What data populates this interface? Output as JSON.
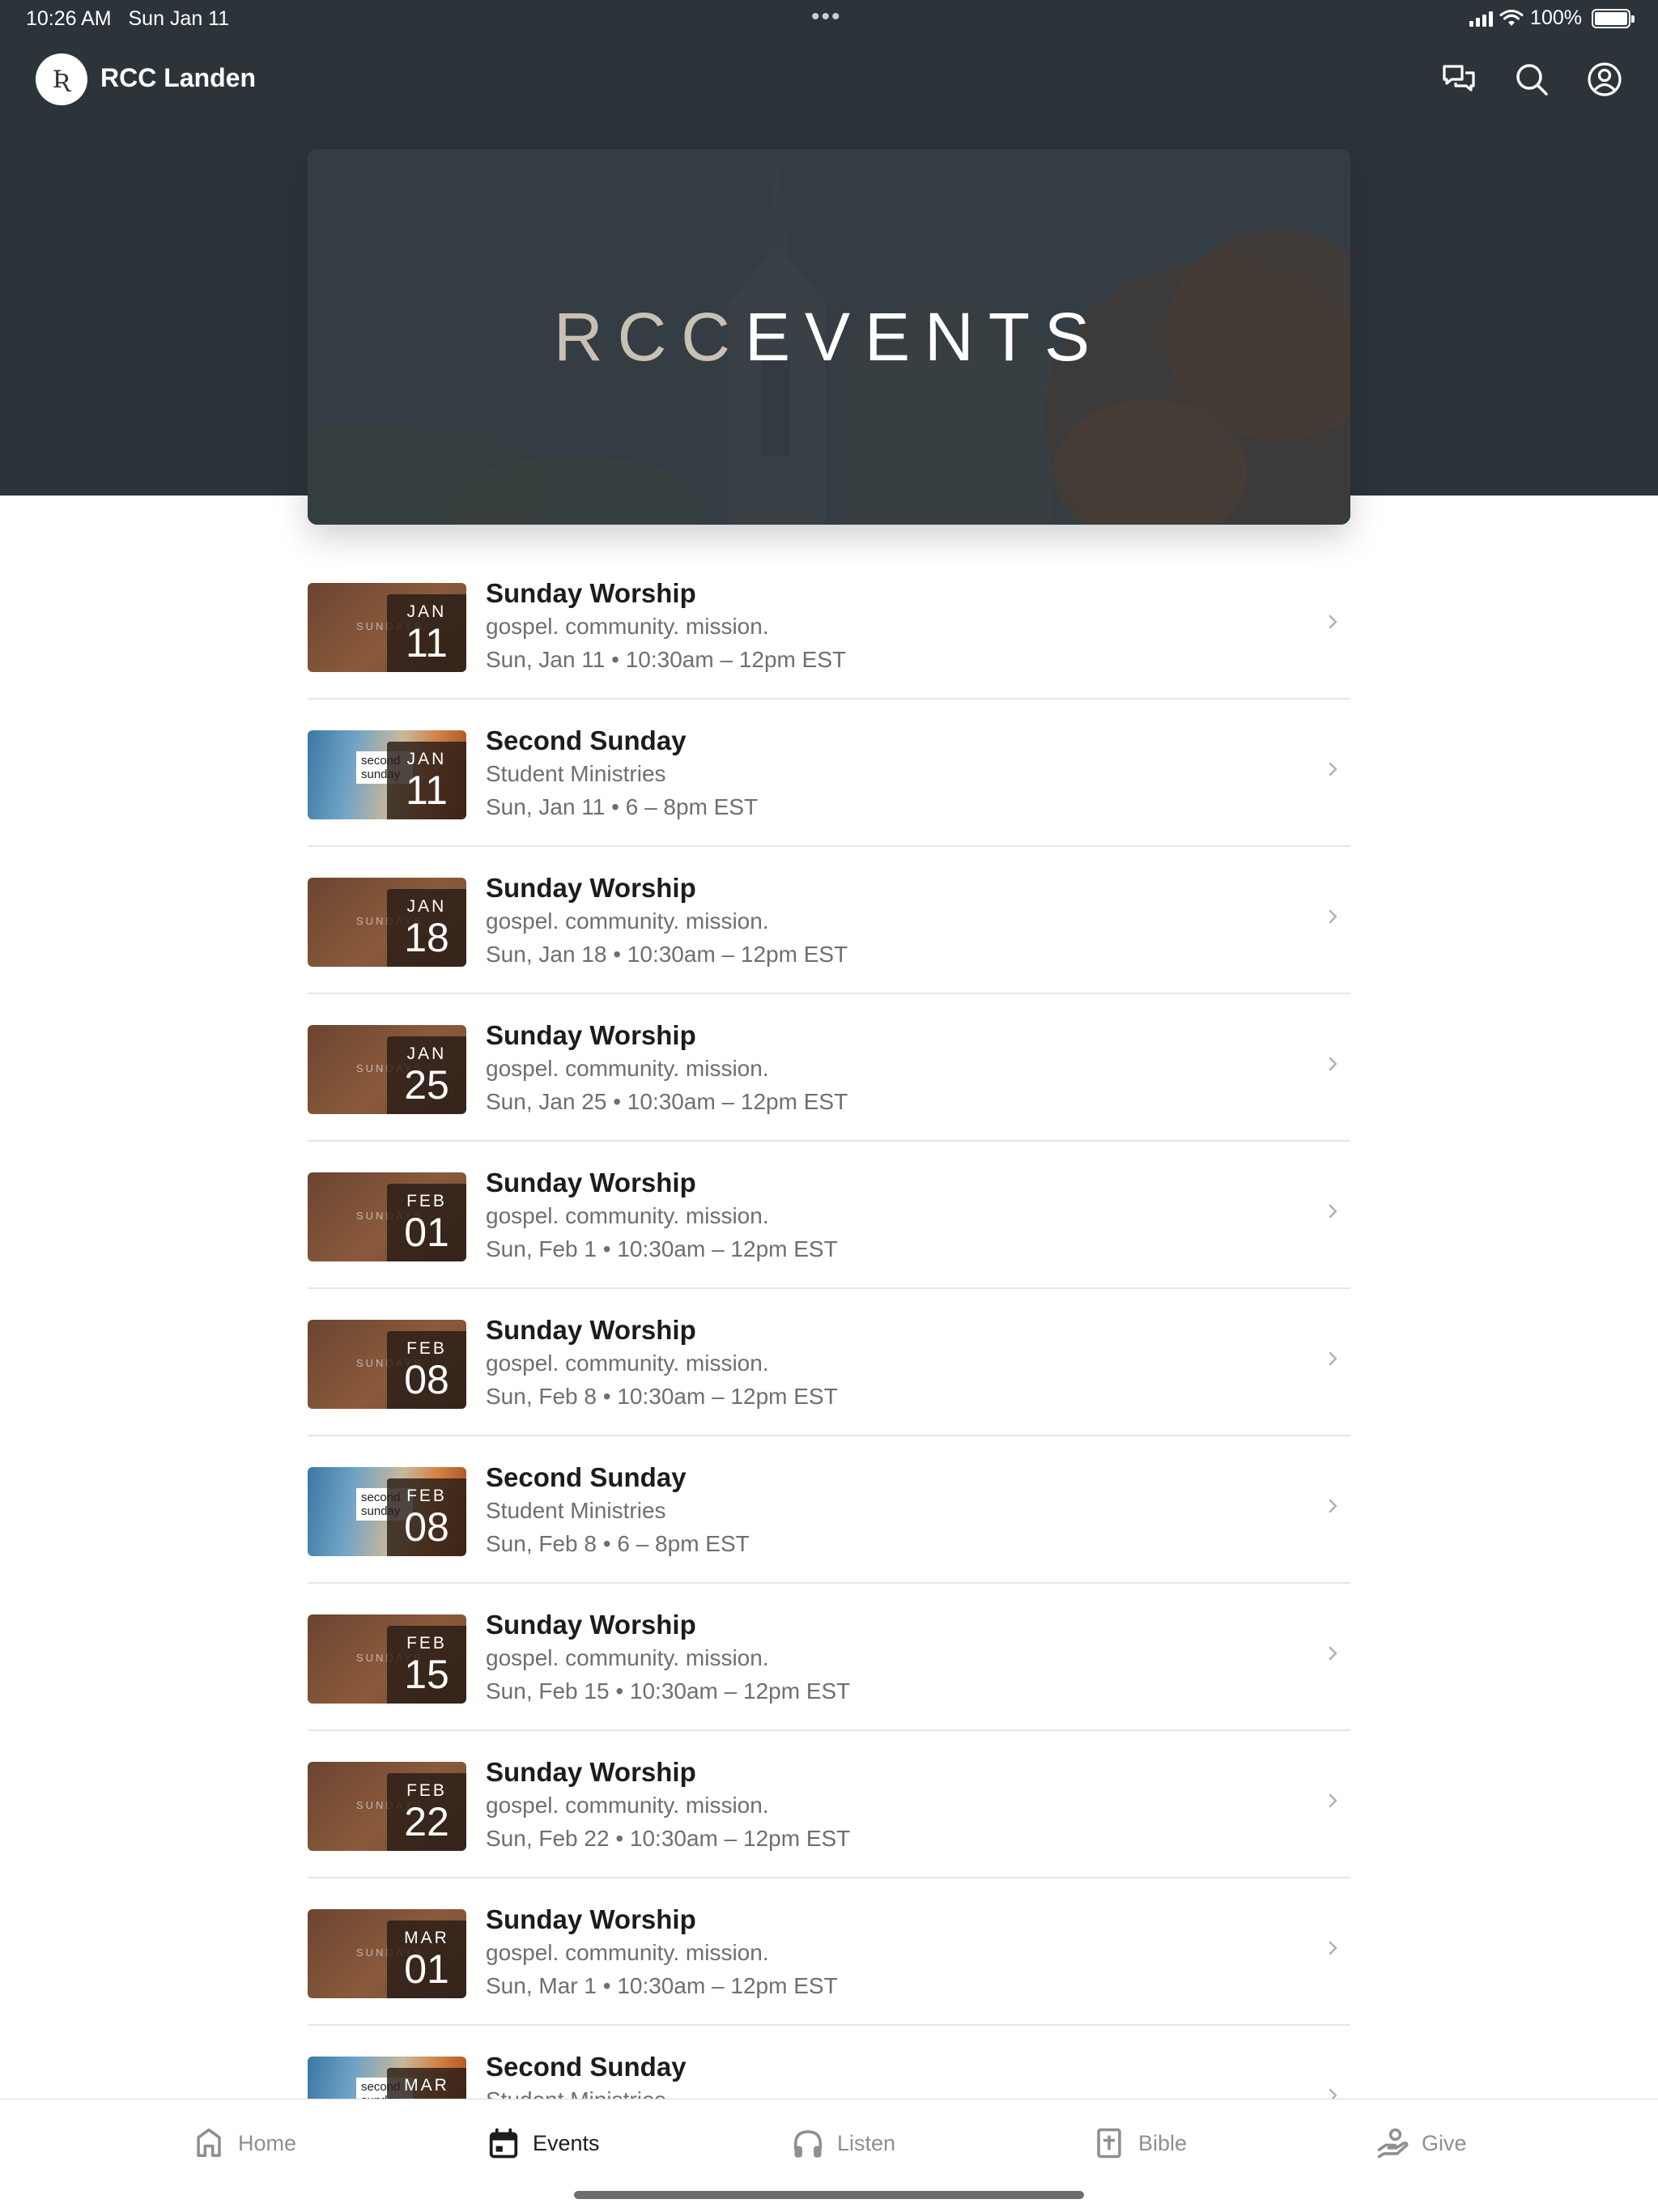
{
  "status_bar": {
    "time": "10:26 AM",
    "date": "Sun Jan 11",
    "dots": "•••",
    "battery": "100%"
  },
  "app_bar": {
    "logo_glyph": "Ʀ",
    "title": "RCC Landen",
    "icons": [
      "chat-icon",
      "search-icon",
      "profile-icon"
    ]
  },
  "hero": {
    "title_left": "RCC",
    "title_right": "EVENTS"
  },
  "events": [
    {
      "style": "sunday",
      "thumb_word": "SUNDAYS",
      "month": "JAN",
      "day": "11",
      "title": "Sunday Worship",
      "subtitle": "gospel. community. mission.",
      "time": "Sun, Jan 11 • 10:30am – 12pm EST"
    },
    {
      "style": "second",
      "thumb_word": "second sunday",
      "month": "JAN",
      "day": "11",
      "title": "Second Sunday",
      "subtitle": "Student Ministries",
      "time": "Sun, Jan 11 • 6 – 8pm EST"
    },
    {
      "style": "sunday",
      "thumb_word": "SUNDAYS",
      "month": "JAN",
      "day": "18",
      "title": "Sunday Worship",
      "subtitle": "gospel. community. mission.",
      "time": "Sun, Jan 18 • 10:30am – 12pm EST"
    },
    {
      "style": "sunday",
      "thumb_word": "SUNDAYS",
      "month": "JAN",
      "day": "25",
      "title": "Sunday Worship",
      "subtitle": "gospel. community. mission.",
      "time": "Sun, Jan 25 • 10:30am – 12pm EST"
    },
    {
      "style": "sunday",
      "thumb_word": "SUNDAYS",
      "month": "FEB",
      "day": "01",
      "title": "Sunday Worship",
      "subtitle": "gospel. community. mission.",
      "time": "Sun, Feb 1 • 10:30am – 12pm EST"
    },
    {
      "style": "sunday",
      "thumb_word": "SUNDAYS",
      "month": "FEB",
      "day": "08",
      "title": "Sunday Worship",
      "subtitle": "gospel. community. mission.",
      "time": "Sun, Feb 8 • 10:30am – 12pm EST"
    },
    {
      "style": "second",
      "thumb_word": "second sunday",
      "month": "FEB",
      "day": "08",
      "title": "Second Sunday",
      "subtitle": "Student Ministries",
      "time": "Sun, Feb 8 • 6 – 8pm EST"
    },
    {
      "style": "sunday",
      "thumb_word": "SUNDAYS",
      "month": "FEB",
      "day": "15",
      "title": "Sunday Worship",
      "subtitle": "gospel. community. mission.",
      "time": "Sun, Feb 15 • 10:30am – 12pm EST"
    },
    {
      "style": "sunday",
      "thumb_word": "SUNDAYS",
      "month": "FEB",
      "day": "22",
      "title": "Sunday Worship",
      "subtitle": "gospel. community. mission.",
      "time": "Sun, Feb 22 • 10:30am – 12pm EST"
    },
    {
      "style": "sunday",
      "thumb_word": "SUNDAYS",
      "month": "MAR",
      "day": "01",
      "title": "Sunday Worship",
      "subtitle": "gospel. community. mission.",
      "time": "Sun, Mar 1 • 10:30am – 12pm EST"
    },
    {
      "style": "second",
      "thumb_word": "second sunday",
      "month": "MAR",
      "day": "",
      "title": "Second Sunday",
      "subtitle": "Student Ministries",
      "time": ""
    }
  ],
  "tab_bar": {
    "tabs": [
      {
        "label": "Home",
        "icon": "home-icon",
        "active": false
      },
      {
        "label": "Events",
        "icon": "calendar-icon",
        "active": true
      },
      {
        "label": "Listen",
        "icon": "headphones-icon",
        "active": false
      },
      {
        "label": "Bible",
        "icon": "bible-icon",
        "active": false
      },
      {
        "label": "Give",
        "icon": "give-icon",
        "active": false
      }
    ]
  }
}
